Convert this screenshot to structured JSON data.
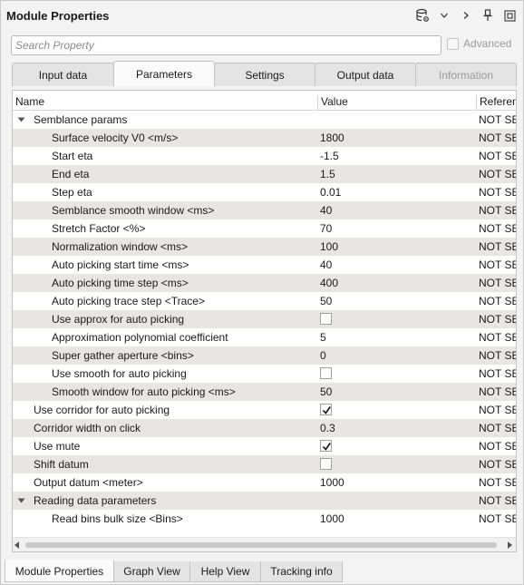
{
  "window": {
    "title": "Module Properties"
  },
  "search": {
    "placeholder": "Search Property",
    "value": ""
  },
  "advanced": {
    "label": "Advanced",
    "checked": false
  },
  "tabs": [
    {
      "label": "Input data",
      "active": false,
      "disabled": false
    },
    {
      "label": "Parameters",
      "active": true,
      "disabled": false
    },
    {
      "label": "Settings",
      "active": false,
      "disabled": false
    },
    {
      "label": "Output data",
      "active": false,
      "disabled": false
    },
    {
      "label": "Information",
      "active": false,
      "disabled": true
    }
  ],
  "table": {
    "columns": {
      "name": "Name",
      "value": "Value",
      "reference": "Referen"
    },
    "rows": [
      {
        "name": "Semblance params",
        "value": "",
        "ref": "NOT SET",
        "level": 0,
        "group": true,
        "expanded": true
      },
      {
        "name": "Surface velocity V0 <m/s>",
        "value": "1800",
        "ref": "NOT SET",
        "level": 1
      },
      {
        "name": "Start eta",
        "value": "-1.5",
        "ref": "NOT SET",
        "level": 1
      },
      {
        "name": "End eta",
        "value": "1.5",
        "ref": "NOT SET",
        "level": 1
      },
      {
        "name": "Step eta",
        "value": "0.01",
        "ref": "NOT SET",
        "level": 1
      },
      {
        "name": "Semblance smooth window <ms>",
        "value": "40",
        "ref": "NOT SET",
        "level": 1
      },
      {
        "name": "Stretch Factor <%>",
        "value": "70",
        "ref": "NOT SET",
        "level": 1
      },
      {
        "name": "Normalization window <ms>",
        "value": "100",
        "ref": "NOT SET",
        "level": 1
      },
      {
        "name": "Auto picking start time <ms>",
        "value": "40",
        "ref": "NOT SET",
        "level": 1
      },
      {
        "name": "Auto picking time step <ms>",
        "value": "400",
        "ref": "NOT SET",
        "level": 1
      },
      {
        "name": "Auto picking trace step <Trace>",
        "value": "50",
        "ref": "NOT SET",
        "level": 1
      },
      {
        "name": "Use approx for auto picking",
        "value": "",
        "checkbox": true,
        "checked": false,
        "ref": "NOT SET",
        "level": 1
      },
      {
        "name": "Approximation polynomial coefficient",
        "value": "5",
        "ref": "NOT SET",
        "level": 1
      },
      {
        "name": "Super gather aperture <bins>",
        "value": "0",
        "ref": "NOT SET",
        "level": 1
      },
      {
        "name": "Use smooth for auto picking",
        "value": "",
        "checkbox": true,
        "checked": false,
        "ref": "NOT SET",
        "level": 1
      },
      {
        "name": "Smooth window for auto picking <ms>",
        "value": "50",
        "ref": "NOT SET",
        "level": 1
      },
      {
        "name": "Use corridor for auto picking",
        "value": "",
        "checkbox": true,
        "checked": true,
        "ref": "NOT SET",
        "level": 0
      },
      {
        "name": "Corridor width on click",
        "value": "0.3",
        "ref": "NOT SET",
        "level": 0
      },
      {
        "name": "Use mute",
        "value": "",
        "checkbox": true,
        "checked": true,
        "ref": "NOT SET",
        "level": 0
      },
      {
        "name": "Shift datum",
        "value": "",
        "checkbox": true,
        "checked": false,
        "ref": "NOT SET",
        "level": 0
      },
      {
        "name": "Output datum <meter>",
        "value": "1000",
        "ref": "NOT SET",
        "level": 0
      },
      {
        "name": "Reading data parameters",
        "value": "",
        "ref": "NOT SET",
        "level": 0,
        "group": true,
        "expanded": true
      },
      {
        "name": "Read bins bulk size <Bins>",
        "value": "1000",
        "ref": "NOT SET",
        "level": 1
      }
    ]
  },
  "bottom_tabs": [
    {
      "label": "Module Properties",
      "active": true
    },
    {
      "label": "Graph View",
      "active": false
    },
    {
      "label": "Help View",
      "active": false
    },
    {
      "label": "Tracking info",
      "active": false
    }
  ],
  "icons": [
    "database-settings-icon",
    "chevron-down-icon",
    "chevron-right-icon",
    "pin-icon",
    "float-window-icon"
  ]
}
